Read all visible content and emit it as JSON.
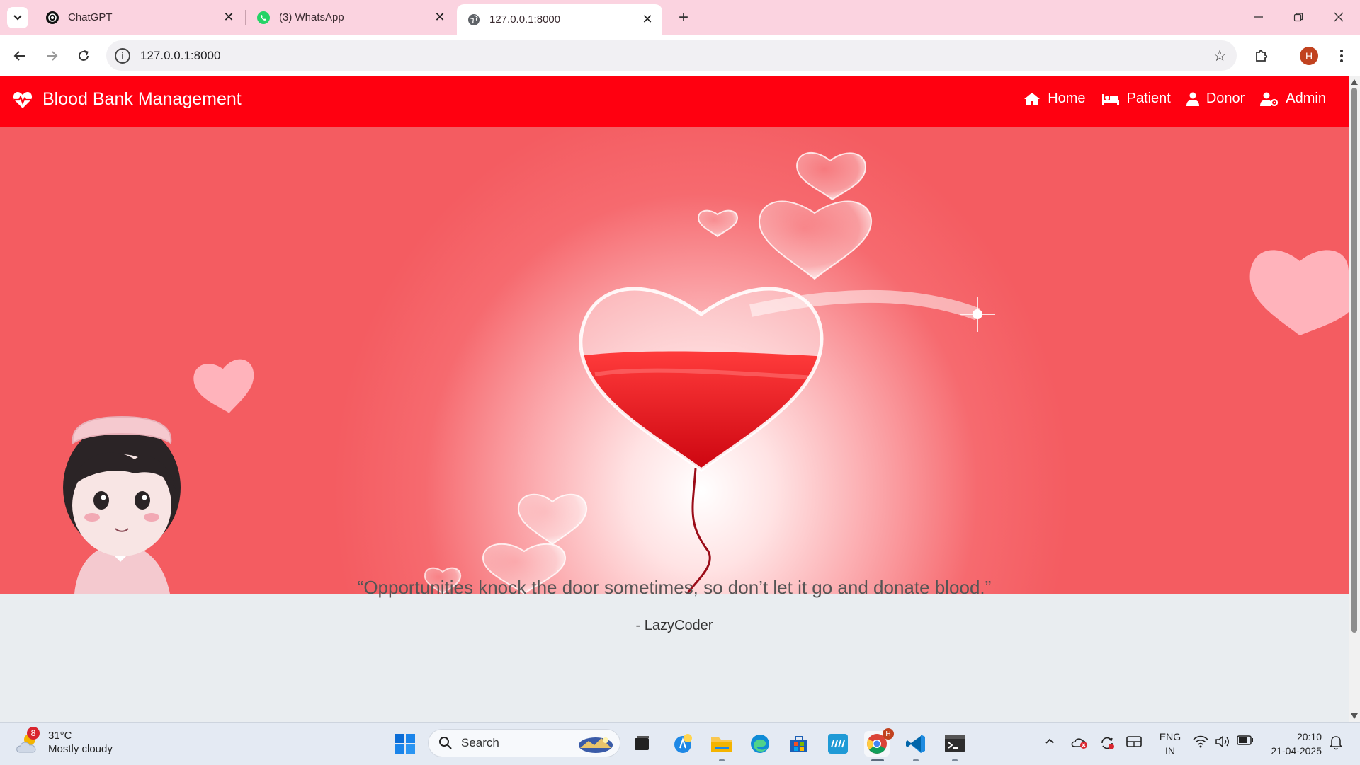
{
  "browser": {
    "tabs": [
      {
        "title": "ChatGPT",
        "icon": "chatgpt-icon"
      },
      {
        "title": "(3) WhatsApp",
        "icon": "whatsapp-icon"
      },
      {
        "title": "127.0.0.1:8000",
        "icon": "globe-icon",
        "active": true
      }
    ],
    "url": "127.0.0.1:8000",
    "profile_initial": "H"
  },
  "site": {
    "brand": "Blood Bank Management",
    "nav": [
      {
        "label": "Home",
        "icon": "home-icon"
      },
      {
        "label": "Patient",
        "icon": "bed-icon"
      },
      {
        "label": "Donor",
        "icon": "user-icon"
      },
      {
        "label": "Admin",
        "icon": "user-cog-icon"
      }
    ],
    "quote": "“Opportunities knock the door sometimes, so don’t let it go and donate blood.”",
    "author": "- LazyCoder"
  },
  "taskbar": {
    "weather_badge": "8",
    "weather_temp": "31°C",
    "weather_desc": "Mostly cloudy",
    "search_label": "Search",
    "chrome_badge": "H",
    "lang_line1": "ENG",
    "lang_line2": "IN",
    "time": "20:10",
    "date": "21-04-2025"
  },
  "colors": {
    "tabbar": "#fbd3e0",
    "navbar": "#ff0010",
    "hero_base": "#f45c61",
    "page_bg": "#e9edf0"
  }
}
